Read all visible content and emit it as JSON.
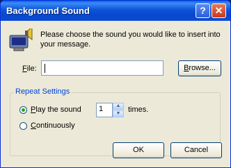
{
  "window": {
    "title": "Background Sound",
    "help_glyph": "?",
    "close_glyph": "✕"
  },
  "prompt": "Please choose the sound you would like to insert into your message.",
  "file": {
    "label_key": "F",
    "label_rest": "ile:",
    "value": ""
  },
  "browse": {
    "label_key": "B",
    "label_rest": "rowse..."
  },
  "repeat": {
    "group_title": "Repeat Settings",
    "play_key": "P",
    "play_rest": "lay the sound",
    "count": "1",
    "times_label": "times.",
    "continuous_key": "C",
    "continuous_rest": "ontinuously",
    "selected": "play"
  },
  "buttons": {
    "ok": "OK",
    "cancel": "Cancel"
  },
  "icons": {
    "main": "speaker-computer-icon",
    "spin_up": "▲",
    "spin_down": "▼"
  }
}
